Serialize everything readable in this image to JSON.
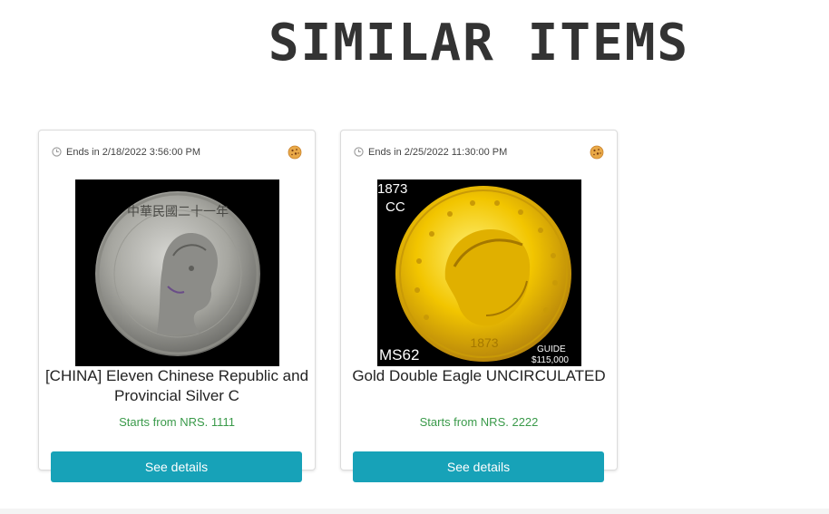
{
  "section": {
    "title": "SIMILAR ITEMS"
  },
  "items": [
    {
      "ends": "Ends in 2/18/2022 3:56:00 PM",
      "title": "[CHINA] Eleven Chinese Republic and Provincial Silver C",
      "price": "Starts from NRS. 1111",
      "button": "See details",
      "image_icon": "silver-coin-portrait",
      "coin_inscription": "中華民國二十一年"
    },
    {
      "ends": "Ends in 2/25/2022 11:30:00 PM",
      "title": "Gold Double Eagle UNCIRCULATED",
      "price": "Starts from NRS. 2222",
      "button": "See details",
      "image_icon": "gold-coin-liberty-head",
      "coin_text": {
        "year": "1873",
        "mint": "CC",
        "grade": "MS62",
        "guide_label": "GUIDE",
        "guide_value": "$115,000",
        "date_on_coin": "1873"
      }
    }
  ],
  "colors": {
    "button": "#17a2b8",
    "price": "#3a9a4a",
    "title": "#333333"
  }
}
